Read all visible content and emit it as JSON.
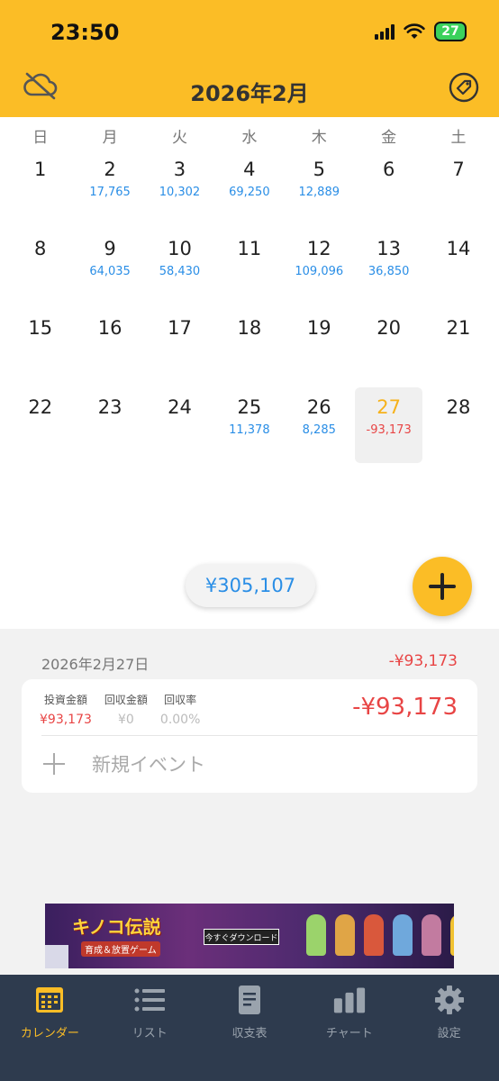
{
  "status": {
    "time": "23:50",
    "battery": "27"
  },
  "header": {
    "title": "2026年2月"
  },
  "weekdays": [
    "日",
    "月",
    "火",
    "水",
    "木",
    "金",
    "土"
  ],
  "calendar": {
    "days": [
      {
        "n": "1",
        "amt": ""
      },
      {
        "n": "2",
        "amt": "17,765"
      },
      {
        "n": "3",
        "amt": "10,302"
      },
      {
        "n": "4",
        "amt": "69,250"
      },
      {
        "n": "5",
        "amt": "12,889"
      },
      {
        "n": "6",
        "amt": ""
      },
      {
        "n": "7",
        "amt": ""
      },
      {
        "n": "8",
        "amt": ""
      },
      {
        "n": "9",
        "amt": "64,035"
      },
      {
        "n": "10",
        "amt": "58,430"
      },
      {
        "n": "11",
        "amt": ""
      },
      {
        "n": "12",
        "amt": "109,096"
      },
      {
        "n": "13",
        "amt": "36,850"
      },
      {
        "n": "14",
        "amt": ""
      },
      {
        "n": "15",
        "amt": ""
      },
      {
        "n": "16",
        "amt": ""
      },
      {
        "n": "17",
        "amt": ""
      },
      {
        "n": "18",
        "amt": ""
      },
      {
        "n": "19",
        "amt": ""
      },
      {
        "n": "20",
        "amt": ""
      },
      {
        "n": "21",
        "amt": ""
      },
      {
        "n": "22",
        "amt": ""
      },
      {
        "n": "23",
        "amt": ""
      },
      {
        "n": "24",
        "amt": ""
      },
      {
        "n": "25",
        "amt": "11,378"
      },
      {
        "n": "26",
        "amt": "8,285"
      },
      {
        "n": "27",
        "amt": "-93,173",
        "today": true
      },
      {
        "n": "28",
        "amt": ""
      }
    ],
    "month_total": "¥305,107"
  },
  "detail": {
    "date": "2026年2月27日",
    "day_total": "-¥93,173",
    "card": {
      "invest_label": "投資金額",
      "invest_value": "¥93,173",
      "return_label": "回収金額",
      "return_value": "¥0",
      "rate_label": "回収率",
      "rate_value": "0.00%",
      "amount": "-¥93,173",
      "new_event": "新規イベント"
    }
  },
  "ad": {
    "title": "キノコ伝説",
    "subtitle": "育成＆放置ゲーム",
    "cta": "今すぐダウンロード"
  },
  "tabs": [
    {
      "label": "カレンダー",
      "icon": "calendar-icon",
      "active": true
    },
    {
      "label": "リスト",
      "icon": "list-icon"
    },
    {
      "label": "収支表",
      "icon": "document-icon"
    },
    {
      "label": "チャート",
      "icon": "bar-chart-icon"
    },
    {
      "label": "設定",
      "icon": "gear-icon"
    }
  ],
  "colors": {
    "accent": "#fbbd26",
    "positive": "#2a8ee6",
    "negative": "#e84545",
    "tabbar": "#2e3b4e"
  }
}
